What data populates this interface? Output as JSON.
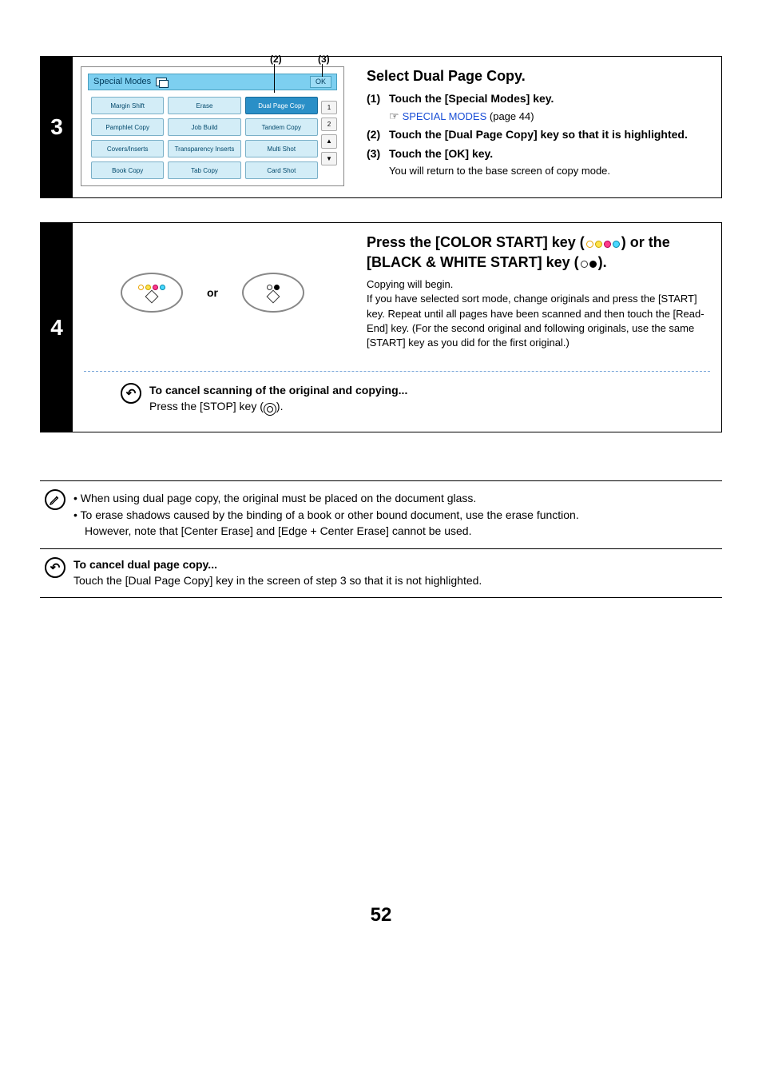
{
  "step3": {
    "number": "3",
    "title": "Select Dual Page Copy.",
    "items": [
      {
        "n": "(1)",
        "bold": "Touch the [Special Modes] key.",
        "link_pre": "☞",
        "link": "SPECIAL MODES",
        "link_after": " (page 44)"
      },
      {
        "n": "(2)",
        "bold": "Touch the [Dual Page Copy] key so that it is highlighted."
      },
      {
        "n": "(3)",
        "bold": "Touch the [OK] key.",
        "sub": "You will return to the base screen of copy mode."
      }
    ],
    "panel": {
      "header": "Special Modes",
      "ok": "OK",
      "callout2": "(2)",
      "callout3": "(3)",
      "buttons": [
        "Margin Shift",
        "Erase",
        "Dual Page Copy",
        "Pamphlet Copy",
        "Job Build",
        "Tandem Copy",
        "Covers/Inserts",
        "Transparency Inserts",
        "Multi Shot",
        "Book Copy",
        "Tab Copy",
        "Card Shot"
      ],
      "frac_top": "1",
      "frac_bot": "2",
      "up": "▲",
      "down": "▼"
    }
  },
  "step4": {
    "number": "4",
    "or": "or",
    "title_a": "Press the [COLOR START] key (",
    "title_b": ") or the [BLACK & WHITE START] key (",
    "title_c": ").",
    "body": "Copying will begin.\nIf you have selected sort mode, change originals and press the [START] key. Repeat until all pages have been scanned and then touch the [Read-End] key. (For the second original and following originals, use the same [START] key as you did for the first original.)",
    "cancel_title": "To cancel scanning of the original and copying...",
    "cancel_body_a": "Press the [STOP] key (",
    "cancel_body_b": ")."
  },
  "notes": {
    "b1": "When using dual page copy, the original must be placed on the document glass.",
    "b2": "To erase shadows caused by the binding of a book or other bound document, use the erase function.",
    "b2_indent": "However, note that [Center Erase] and [Edge + Center Erase] cannot be used.",
    "cancel_title": "To cancel dual page copy...",
    "cancel_body": "Touch the [Dual Page Copy] key in the screen of step 3 so that it is not highlighted."
  },
  "page": "52"
}
